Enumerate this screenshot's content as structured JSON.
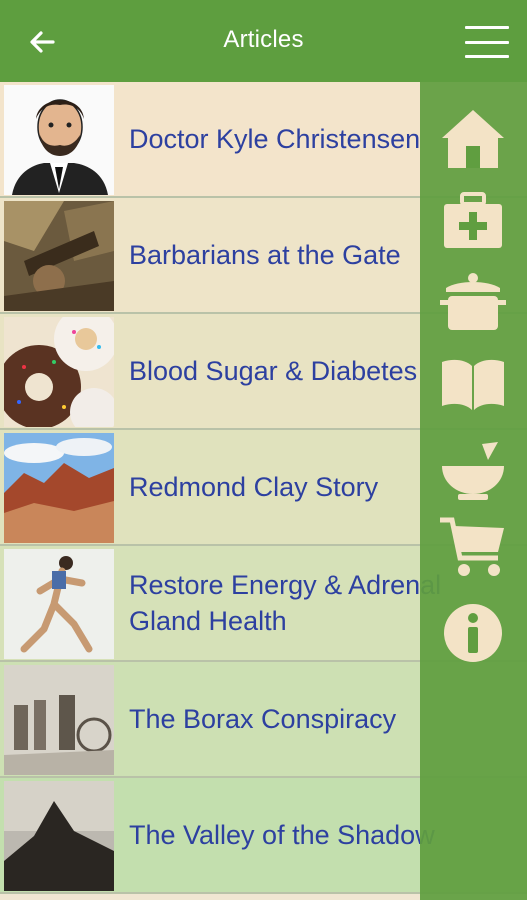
{
  "header": {
    "title": "Articles"
  },
  "colors": {
    "appbar": "#5e9e3f",
    "sidebar": "#609e40",
    "title_text": "#2d40a0",
    "icon_fill": "#f3e3c6"
  },
  "articles": [
    {
      "title": "Doctor Kyle Christensen",
      "thumb": "portrait-illustration"
    },
    {
      "title": "Barbarians at the Gate",
      "thumb": "battle-scene"
    },
    {
      "title": "Blood Sugar & Diabetes",
      "thumb": "donuts"
    },
    {
      "title": "Redmond Clay Story",
      "thumb": "red-rock-desert"
    },
    {
      "title": "Restore Energy & Adrenal\nGland Health",
      "thumb": "runner"
    },
    {
      "title": "The Borax Conspiracy",
      "thumb": "old-photo"
    },
    {
      "title": "The Valley of the Shadow",
      "thumb": "mountain-silhouette"
    }
  ],
  "side_menu": [
    {
      "icon": "home-icon"
    },
    {
      "icon": "medical-kit-icon"
    },
    {
      "icon": "cooking-pot-icon"
    },
    {
      "icon": "book-icon"
    },
    {
      "icon": "mortar-pestle-icon"
    },
    {
      "icon": "shopping-cart-icon"
    },
    {
      "icon": "info-icon"
    }
  ]
}
